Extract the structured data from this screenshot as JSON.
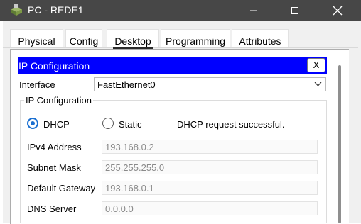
{
  "window": {
    "title": "PC - REDE1",
    "icon": "cisco-pc-icon"
  },
  "tabs": [
    {
      "label": "Physical"
    },
    {
      "label": "Config"
    },
    {
      "label": "Desktop",
      "active": true
    },
    {
      "label": "Programming"
    },
    {
      "label": "Attributes"
    }
  ],
  "ip_config": {
    "title": "IP Configuration",
    "close_label": "X",
    "interface_label": "Interface",
    "interface_value": "FastEthernet0",
    "group_title": "IP Configuration",
    "dhcp_label": "DHCP",
    "static_label": "Static",
    "mode_selected": "DHCP",
    "status": "DHCP request successful.",
    "fields": [
      {
        "label": "IPv4 Address",
        "value": "193.168.0.2"
      },
      {
        "label": "Subnet Mask",
        "value": "255.255.255.0"
      },
      {
        "label": "Default Gateway",
        "value": "193.168.0.1"
      },
      {
        "label": "DNS Server",
        "value": "0.0.0.0"
      }
    ]
  },
  "colors": {
    "titlebar": "#474747",
    "header_blue": "#0000ff",
    "radio_accent": "#1a6fd1"
  }
}
